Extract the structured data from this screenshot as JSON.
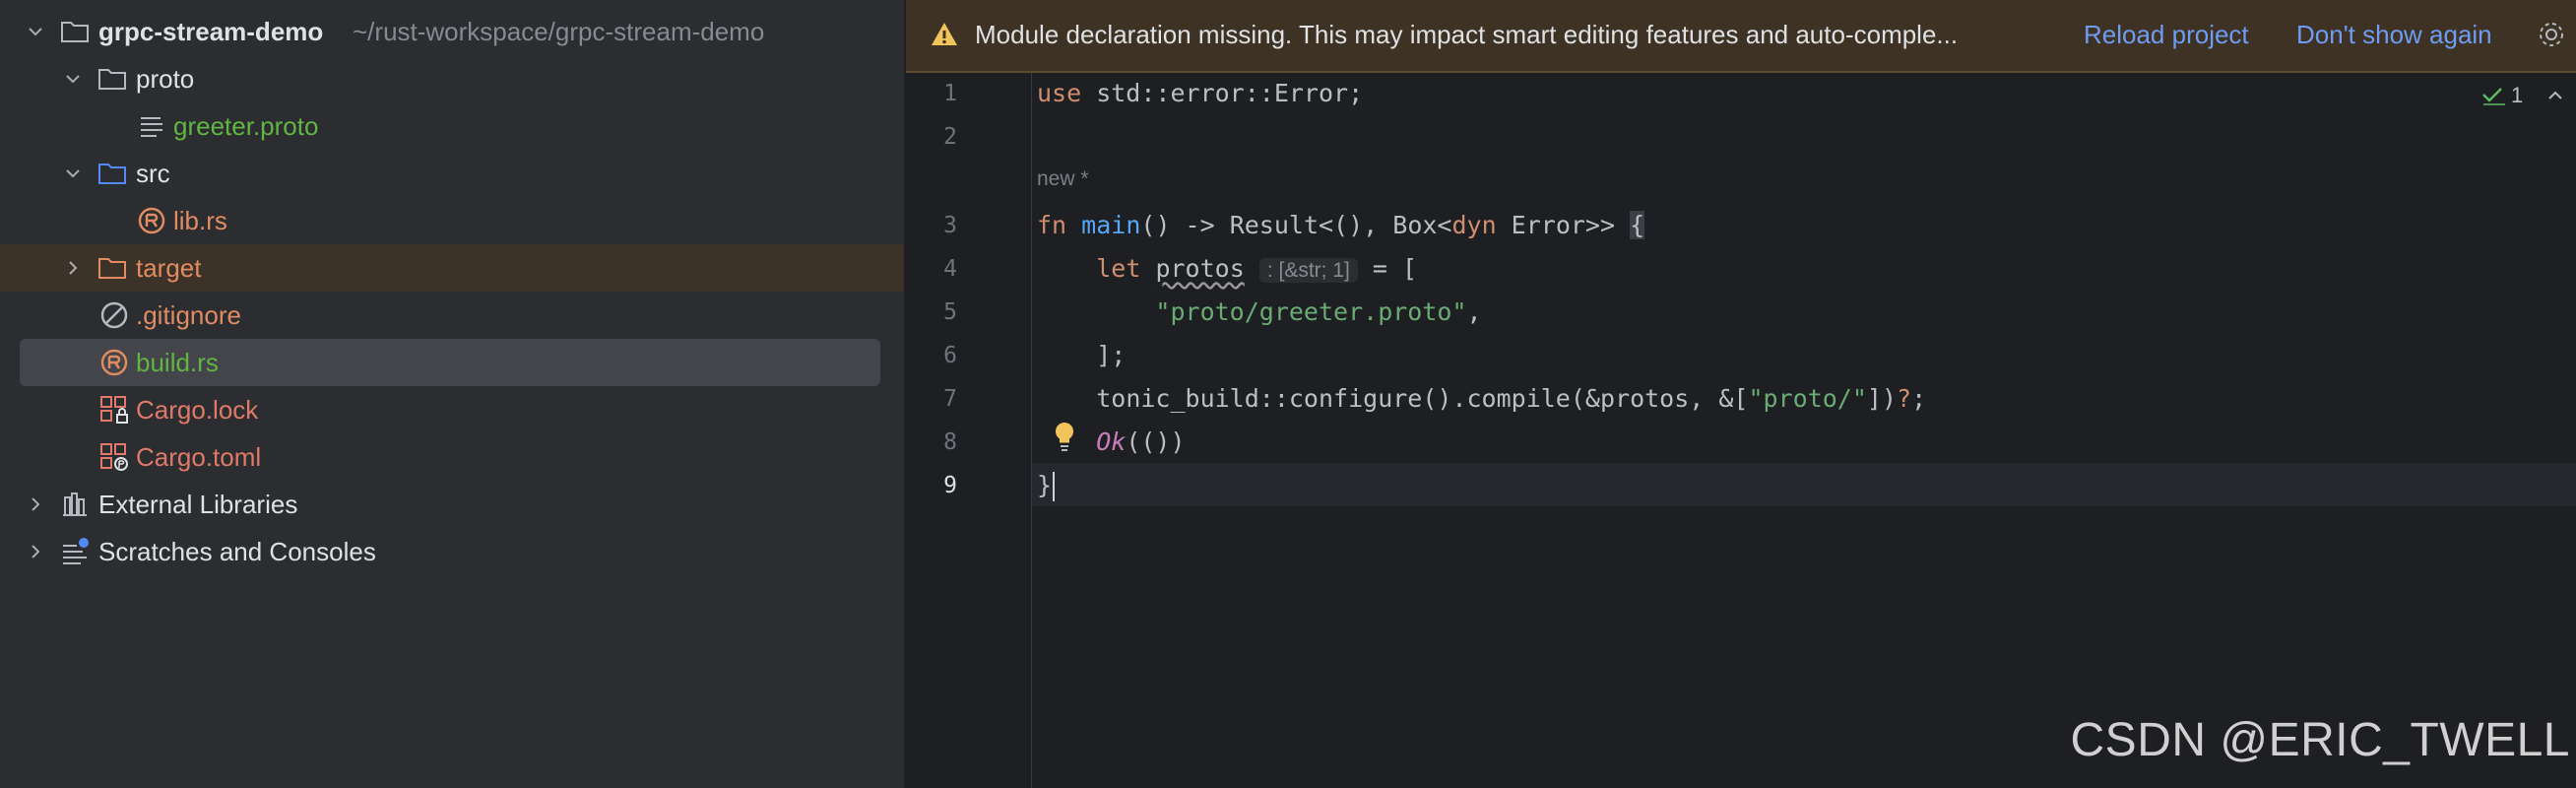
{
  "project_tree": {
    "root": {
      "name": "grpc-stream-demo",
      "path": "~/rust-workspace/grpc-stream-demo"
    },
    "proto_folder": "proto",
    "greeter_proto": "greeter.proto",
    "src_folder": "src",
    "lib_rs": "lib.rs",
    "target_folder": "target",
    "gitignore": ".gitignore",
    "build_rs": "build.rs",
    "cargo_lock": "Cargo.lock",
    "cargo_toml": "Cargo.toml",
    "external_libraries": "External Libraries",
    "scratches": "Scratches and Consoles"
  },
  "banner": {
    "message": "Module declaration missing. This may impact smart editing features and auto-comple...",
    "reload_label": "Reload project",
    "dismiss_label": "Don't show again"
  },
  "editor": {
    "line_numbers": [
      "1",
      "2",
      "3",
      "4",
      "5",
      "6",
      "7",
      "8",
      "9"
    ],
    "active_line": "9",
    "new_marker": "new *",
    "inlay_hint": ": [&str; 1]",
    "inspection_count": "1",
    "code": {
      "l1_kw": "use",
      "l1_rest": " std::error::Error;",
      "l3_kw": "fn",
      "l3_fn": "main",
      "l3_a": "() -> Result<(), Box<",
      "l3_dyn": "dyn",
      "l3_b": " Error>> ",
      "l3_brace": "{",
      "l4_kw": "let",
      "l4_var": "protos",
      "l4_rest": " = [",
      "l5_str": "\"proto/greeter.proto\"",
      "l5_rest": ",",
      "l6": "];",
      "l7_a": "tonic_build::configure().compile(&protos, &[",
      "l7_str": "\"proto/\"",
      "l7_b": "])",
      "l7_q": "?",
      "l7_c": ";",
      "l8_ok": "Ok",
      "l8_rest": "(())",
      "l9": "}"
    }
  },
  "watermark": "CSDN @ERIC_TWELL"
}
